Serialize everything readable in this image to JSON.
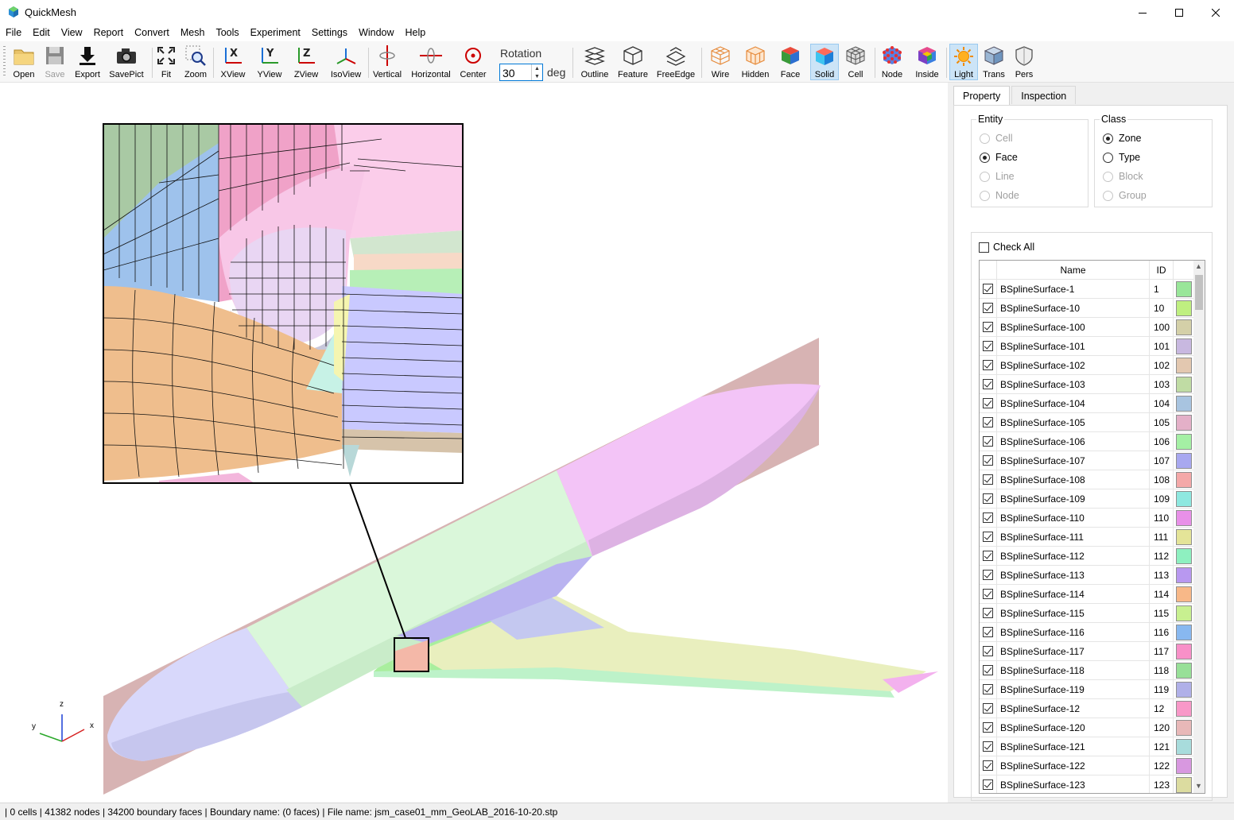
{
  "window": {
    "title": "QuickMesh"
  },
  "menu": [
    "File",
    "Edit",
    "View",
    "Report",
    "Convert",
    "Mesh",
    "Tools",
    "Experiment",
    "Settings",
    "Window",
    "Help"
  ],
  "toolbar": {
    "open": "Open",
    "save": "Save",
    "export": "Export",
    "savepict": "SavePict",
    "fit": "Fit",
    "zoom": "Zoom",
    "xview": "XView",
    "yview": "YView",
    "zview": "ZView",
    "isoview": "IsoView",
    "vertical": "Vertical",
    "horizontal": "Horizontal",
    "center": "Center",
    "rotation_label": "Rotation",
    "rotation_value": "30",
    "rotation_unit": "deg",
    "outline": "Outline",
    "feature": "Feature",
    "freeedge": "FreeEdge",
    "wire": "Wire",
    "hidden": "Hidden",
    "face": "Face",
    "solid": "Solid",
    "cell": "Cell",
    "node": "Node",
    "inside": "Inside",
    "light": "Light",
    "trans": "Trans",
    "pers": "Pers"
  },
  "axes": {
    "z": "z",
    "y": "y",
    "x": "x"
  },
  "panel": {
    "tabs": [
      "Property",
      "Inspection"
    ],
    "entity": {
      "title": "Entity",
      "options": [
        "Cell",
        "Face",
        "Line",
        "Node"
      ],
      "selected": "Face"
    },
    "class": {
      "title": "Class",
      "options": [
        "Zone",
        "Type",
        "Block",
        "Group"
      ],
      "selected": "Zone"
    },
    "check_all": "Check All",
    "columns": {
      "name": "Name",
      "id": "ID"
    },
    "rows": [
      {
        "name": "BSplineSurface-1",
        "id": "1",
        "color": "#99e699"
      },
      {
        "name": "BSplineSurface-10",
        "id": "10",
        "color": "#bfef80"
      },
      {
        "name": "BSplineSurface-100",
        "id": "100",
        "color": "#d4d0a8"
      },
      {
        "name": "BSplineSurface-101",
        "id": "101",
        "color": "#c8b8e0"
      },
      {
        "name": "BSplineSurface-102",
        "id": "102",
        "color": "#e3c8b0"
      },
      {
        "name": "BSplineSurface-103",
        "id": "103",
        "color": "#c0dca4"
      },
      {
        "name": "BSplineSurface-104",
        "id": "104",
        "color": "#a8c4e0"
      },
      {
        "name": "BSplineSurface-105",
        "id": "105",
        "color": "#e4b0c8"
      },
      {
        "name": "BSplineSurface-106",
        "id": "106",
        "color": "#a4f0a4"
      },
      {
        "name": "BSplineSurface-107",
        "id": "107",
        "color": "#a8a8f0"
      },
      {
        "name": "BSplineSurface-108",
        "id": "108",
        "color": "#f4a8a8"
      },
      {
        "name": "BSplineSurface-109",
        "id": "109",
        "color": "#8ee8e0"
      },
      {
        "name": "BSplineSurface-110",
        "id": "110",
        "color": "#e890e8"
      },
      {
        "name": "BSplineSurface-111",
        "id": "111",
        "color": "#e4e498"
      },
      {
        "name": "BSplineSurface-112",
        "id": "112",
        "color": "#8ef0c0"
      },
      {
        "name": "BSplineSurface-113",
        "id": "113",
        "color": "#b898f0"
      },
      {
        "name": "BSplineSurface-114",
        "id": "114",
        "color": "#f8b888"
      },
      {
        "name": "BSplineSurface-115",
        "id": "115",
        "color": "#c8f090"
      },
      {
        "name": "BSplineSurface-116",
        "id": "116",
        "color": "#88b8f0"
      },
      {
        "name": "BSplineSurface-117",
        "id": "117",
        "color": "#f890c8"
      },
      {
        "name": "BSplineSurface-118",
        "id": "118",
        "color": "#98e098"
      },
      {
        "name": "BSplineSurface-119",
        "id": "119",
        "color": "#b0b0e8"
      },
      {
        "name": "BSplineSurface-12",
        "id": "12",
        "color": "#f898c8"
      },
      {
        "name": "BSplineSurface-120",
        "id": "120",
        "color": "#e8b8b8"
      },
      {
        "name": "BSplineSurface-121",
        "id": "121",
        "color": "#a8dcdc"
      },
      {
        "name": "BSplineSurface-122",
        "id": "122",
        "color": "#d898e0"
      },
      {
        "name": "BSplineSurface-123",
        "id": "123",
        "color": "#dcdca0"
      }
    ]
  },
  "status": "| 0 cells | 41382 nodes | 34200 boundary faces |  Boundary name:  (0 faces) | File name: jsm_case01_mm_GeoLAB_2016-10-20.stp"
}
